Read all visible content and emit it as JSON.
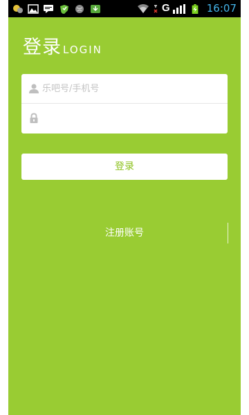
{
  "status_bar": {
    "time": "16:07",
    "network_label": "G",
    "icons": [
      "notification-app-icon",
      "image-icon",
      "chat-icon",
      "shield-icon",
      "globe-icon",
      "download-icon",
      "wifi-icon",
      "signal-icon",
      "battery-charging-icon"
    ]
  },
  "header": {
    "title": "登录",
    "subtitle": "LOGIN"
  },
  "form": {
    "account_placeholder": "乐吧号/手机号",
    "account_value": "",
    "password_placeholder": "",
    "password_value": ""
  },
  "actions": {
    "login_label": "登录",
    "register_label": "注册账号"
  },
  "colors": {
    "background": "#99cc33",
    "button_text": "#8dc21f",
    "clock": "#44b3e8"
  }
}
